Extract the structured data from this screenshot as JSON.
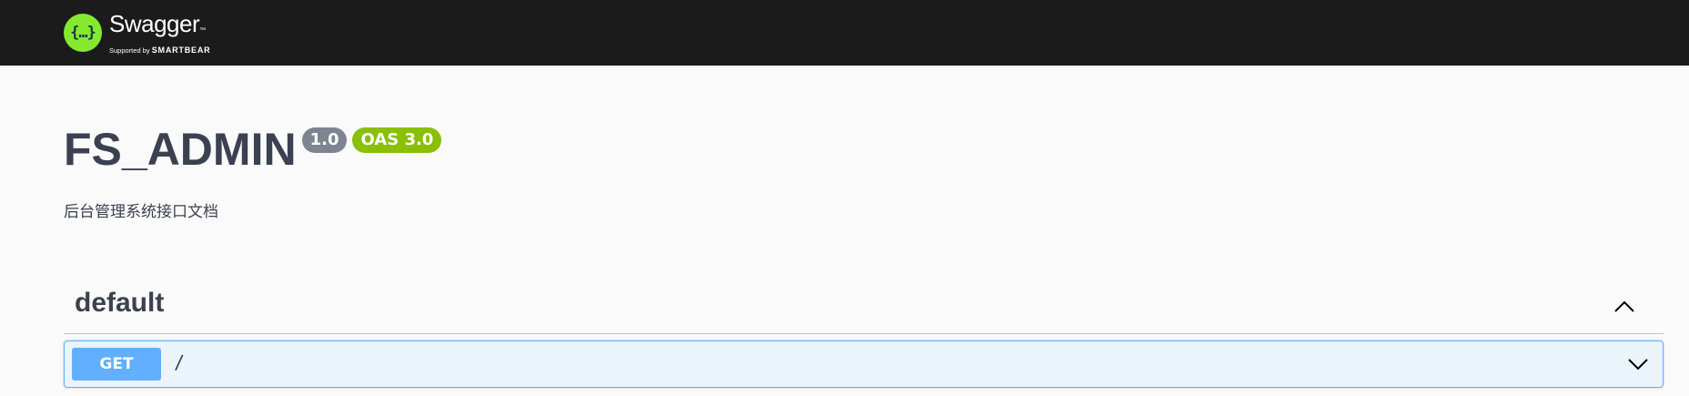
{
  "header": {
    "logo_glyph": "{…}",
    "brand_name": "Swagger",
    "brand_tm": "™",
    "supported_by": "Supported by",
    "supporter": "SMARTBEAR"
  },
  "info": {
    "title": "FS_ADMIN",
    "version": "1.0",
    "oas": "OAS 3.0",
    "description": "后台管理系统接口文档"
  },
  "tag": {
    "name": "default",
    "toggle_icon": "chevron-up-icon"
  },
  "operations": [
    {
      "method": "GET",
      "path": "/",
      "toggle_icon": "chevron-down-icon"
    }
  ],
  "colors": {
    "topbar": "#1b1b1b",
    "logo": "#85ea2d",
    "version_badge": "#7d8492",
    "oas_badge": "#89bf04",
    "get_method": "#61affe",
    "get_bg": "#ebf3fb",
    "text": "#3b4151"
  }
}
